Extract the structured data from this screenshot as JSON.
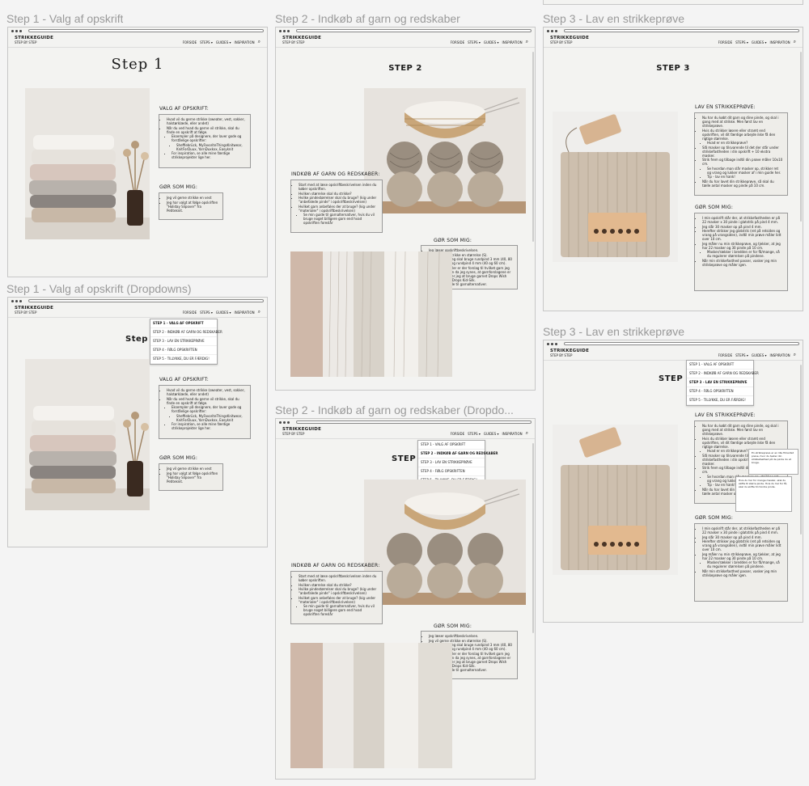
{
  "frames": [
    {
      "title": "Step 1 - Valg af opskrift"
    },
    {
      "title": "Step 1 - Valg af opskrift (Dropdowns)"
    },
    {
      "title": "Step 2 - Indkøb af garn og redskaber"
    },
    {
      "title": "Step 2 - Indkøb af garn og redskaber (Dropdo..."
    },
    {
      "title": "Step 3 - Lav en strikkeprøve"
    },
    {
      "title": "Step 3 - Lav en strikkeprøve"
    }
  ],
  "site": {
    "brand": "STRIKKEGUIDE",
    "tagline": "STEP BY STEP",
    "url": "www.strikkeguide.com",
    "nav": [
      "FORSIDE",
      "STEPS ▾",
      "GUIDES ▾",
      "INSPIRATION"
    ]
  },
  "dropdown_items": [
    "STEP 1 - VALG AF OPSKRIFT",
    "STEP 2 - INDKØB AF GARN OG REDSKABER",
    "STEP 3 - LAV EN STRIKKEPRØVE",
    "STEP 4 - FØLG OPSKRIFTEN",
    "STEP 5 - TILLYKKE, DU ER FÆRDIG!"
  ],
  "step1": {
    "heading": "Step 1",
    "section_title": "VALG AF OPSKRIFT:",
    "bullets": [
      "Hvad vil du gerne strikke (sweater, vest, sokker, halstørklæde, eller andet)",
      "Når du ved hvad du gerne vil strikke, skal du finde en opskrift at følge.",
      "Eksempler på designere, der laver gode og forståelige opskrifter:",
      "Sheffiebrück, MyFavoriteThingsKnitwear, KnitForDuux, YarnDuxkxx, Easyknit",
      "For inspiration, se alle mine færdige strikkeprojekter lige her."
    ],
    "do_title": "GØR SOM MIG:",
    "do_bullets": [
      "Jeg vil gerne strikke en vest",
      "Jeg har valgt at følge opskriften \"Holiday Slipover\" fra Petiteknit."
    ]
  },
  "step2": {
    "heading": "STEP 2",
    "section_title": "INDKØB AF GARN OG REDSKABER:",
    "bullets": [
      "Start med at læse opskriftbeskrivelsen inden du køber opskriften.",
      "Hvilken størrelse skal du strikke?",
      "Hvilke pindestørrelser skal du bruge? (kig under \"anbefalede pinde\" i opskriftbeskrivelsen)",
      "Hvilket garn anbefales der at bruge? (kig under \"materialer\" i opskriftbeskrivelsen)",
      "Se min guide til garnalternativer, hvis du vil bruge noget billigere garn end hvad opskriften foreslår"
    ],
    "do_title": "GØR SOM MIG:",
    "do_bullets": [
      "Jeg læser opskriftbeskrivelsen.",
      "Jeg vil gerne strikke en størrelse (S).",
      "Den siger, at jeg skal bruge rundpind 3 mm (40, 80 eller 100 cm) og rundpind 4 mm (40 og 60 cm).",
      "Under materialer er der forslag til hvilket garn jeg kan bruge. Men da jeg synes, at garnforslagene er for dyre, vælger jeg at bruge garnet Drops Wish sammen med Drops Kid-Silk.",
      "Se min guide til garnalternativer."
    ]
  },
  "step3": {
    "heading": "STEP 3",
    "section_title": "LAV EN STRIKKEPRØVE:",
    "bullets": [
      "Nu har du købt dit garn og dine pinde, og skal i gang med at strikke. Men først lav en strikkeprøve.",
      "Hvis du strikker løsere eller stramt end opskriften, vil dit færdige arbejde ikke få den rigtige størrelse.",
      "Hvad er en strikkeprøve?",
      "Slå masker op tilsvarende til det der står under strikkefastheden i din opskrift + 10 ekstra masker.",
      "Strik frem og tilbage indtil din prøve måler 10x10 cm.",
      "Se hvordan man slår masker op, strikker ret og vrang og lukker masker af i min guide her.",
      "Tip - lav en hank!",
      "Når du har lavet din strikkeprøve, så skal du tælle antal masker og pinde på 10 cm."
    ],
    "do_title": "GØR SOM MIG:",
    "do_bullets": [
      "I min opskrift står der, at strikkefastheden er på 22 masker x 30 pinde i glatstrik på pind 4 mm.",
      "Jeg slår 30 masker op på pind 4 mm.",
      "Herefter strikker jeg glatstrik (ret på retsiden og vrang på vrangsiden), indtil min prøve måler lidt over 10 cm.",
      "Jeg måler nu min strikkeprøve, og tjekker, at jeg har 22 masker og 30 pinde på 10 cm.",
      "Masker/rækker i bredden er for få/mange, så du regulerer størrelsen på pindene.",
      "Når min strikkefasthed passer, vasker jeg min strikkeprøve og måler igen."
    ]
  },
  "tooltips": [
    "En strikkeprøve er en lille firkantet prøve, hvor du tester din strikkefasthed på de pinde du vil bruge.",
    "Hvis du har for mange masker, skal du skifte til større pinde. Hvis du har for få, skal du skifte til mindre pinde."
  ],
  "colors": {
    "accent": "#c9a98a",
    "page_bg": "#f3f3f1",
    "canvas_bg": "#f4f4f4"
  }
}
